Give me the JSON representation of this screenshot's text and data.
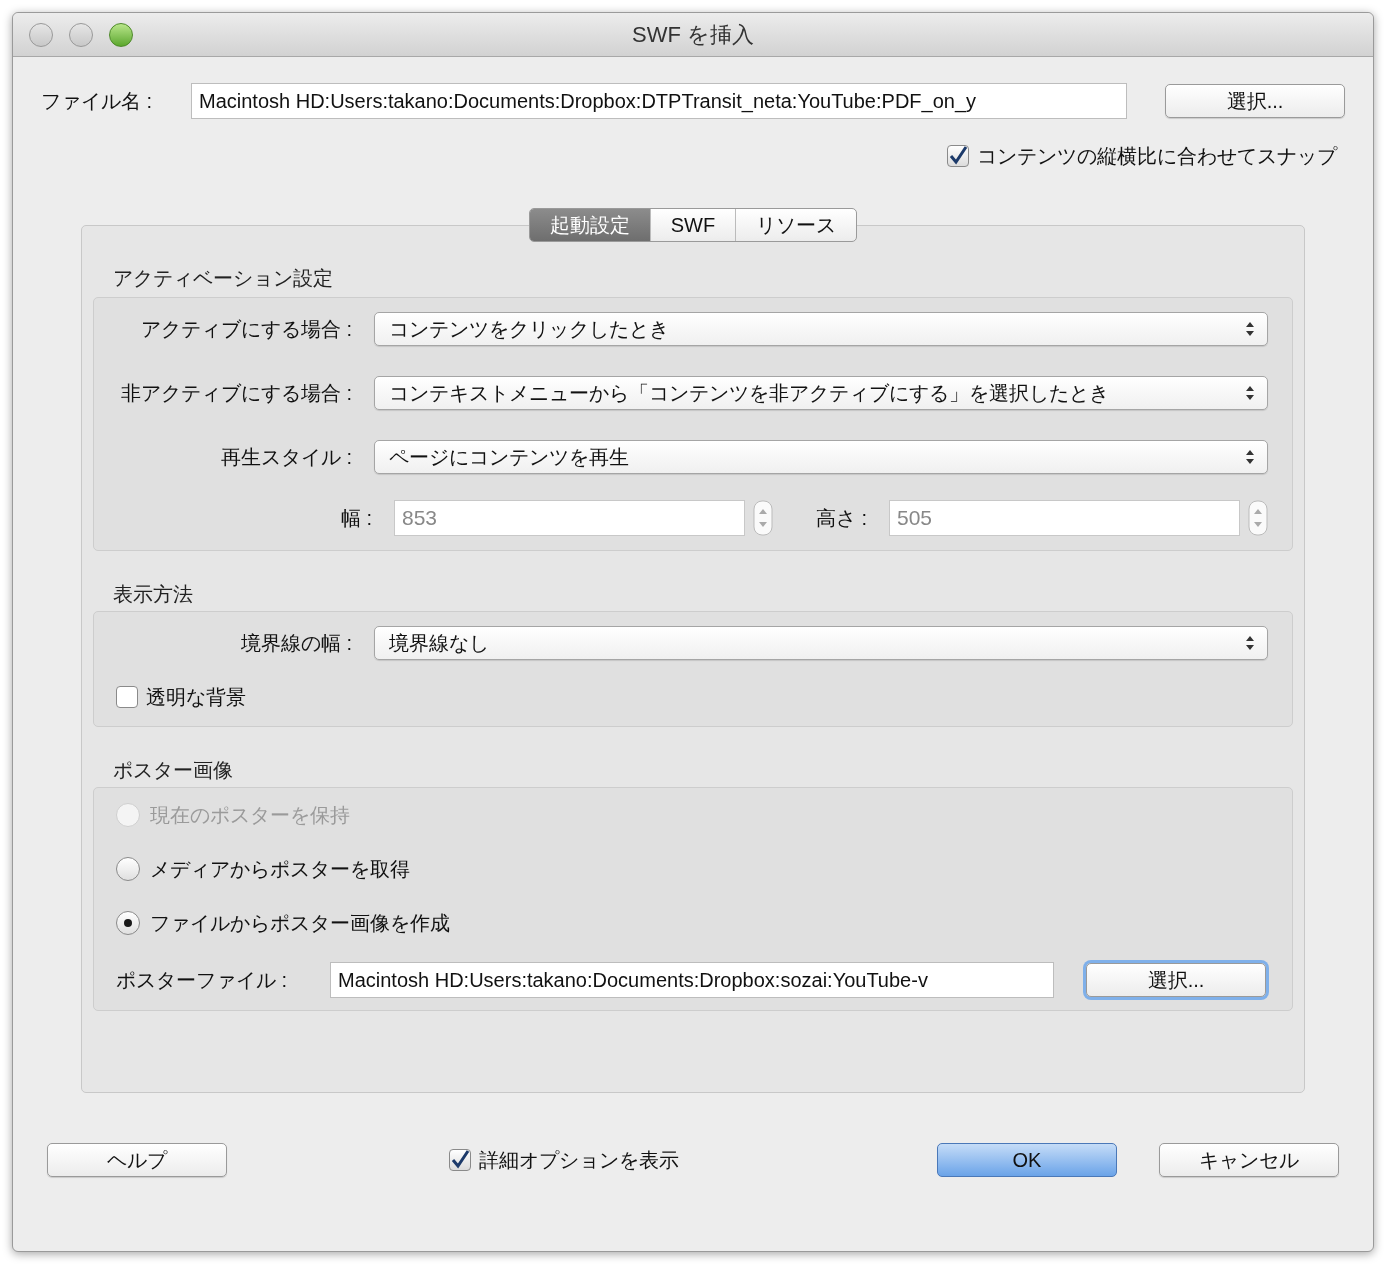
{
  "window": {
    "title": "SWF を挿入"
  },
  "file": {
    "label": "ファイル名 :",
    "value": "Macintosh HD:Users:takano:Documents:Dropbox:DTPTransit_neta:YouTube:PDF_on_y",
    "button": "選択..."
  },
  "snap": {
    "label": "コンテンツの縦横比に合わせてスナップ",
    "checked": true
  },
  "tabs": [
    {
      "label": "起動設定",
      "selected": true
    },
    {
      "label": "SWF",
      "selected": false
    },
    {
      "label": "リソース",
      "selected": false
    }
  ],
  "activation": {
    "heading": "アクティベーション設定",
    "selects": [
      {
        "label": "アクティブにする場合 :",
        "value": "コンテンツをクリックしたとき"
      },
      {
        "label": "非アクティブにする場合 :",
        "value": "コンテキストメニューから「コンテンツを非アクティブにする」を選択したとき"
      },
      {
        "label": "再生スタイル :",
        "value": "ページにコンテンツを再生"
      }
    ],
    "width": {
      "label": "幅 :",
      "value": "853",
      "disabled": true
    },
    "height": {
      "label": "高さ :",
      "value": "505",
      "disabled": true
    }
  },
  "display": {
    "heading": "表示方法",
    "border": {
      "label": "境界線の幅 :",
      "value": "境界線なし"
    },
    "transparent": {
      "label": "透明な背景",
      "checked": false
    }
  },
  "poster": {
    "heading": "ポスター画像",
    "options": [
      {
        "label": "現在のポスターを保持",
        "selected": false,
        "disabled": true
      },
      {
        "label": "メディアからポスターを取得",
        "selected": false,
        "disabled": false
      },
      {
        "label": "ファイルからポスター画像を作成",
        "selected": true,
        "disabled": false
      }
    ],
    "file": {
      "label": "ポスターファイル :",
      "value": "Macintosh HD:Users:takano:Documents:Dropbox:sozai:YouTube-v",
      "button": "選択..."
    }
  },
  "footer": {
    "help": "ヘルプ",
    "details": {
      "label": "詳細オプションを表示",
      "checked": true
    },
    "ok": "OK",
    "cancel": "キャンセル"
  }
}
